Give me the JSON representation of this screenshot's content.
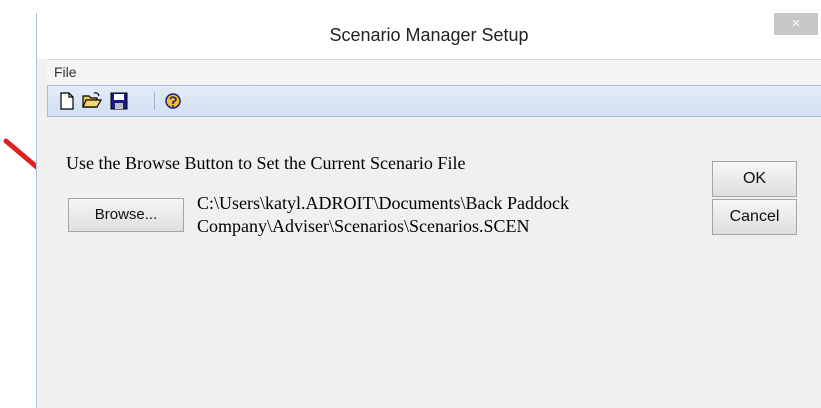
{
  "window": {
    "title": "Scenario Manager Setup",
    "close_label": "×"
  },
  "menubar": {
    "items": [
      {
        "label": "File"
      }
    ]
  },
  "toolbar": {
    "buttons": [
      {
        "icon": "new-file-icon"
      },
      {
        "icon": "open-folder-icon"
      },
      {
        "icon": "save-icon"
      },
      {
        "icon": "help-icon"
      }
    ]
  },
  "content": {
    "instruction": "Use the Browse Button to Set the Current Scenario File",
    "browse_label": "Browse...",
    "path_line1": "C:\\Users\\katyl.ADROIT\\Documents\\Back Paddock",
    "path_line2": "Company\\Adviser\\Scenarios\\Scenarios.SCEN"
  },
  "actions": {
    "ok_label": "OK",
    "cancel_label": "Cancel"
  },
  "annotation": {
    "arrow_color": "#e02020"
  }
}
